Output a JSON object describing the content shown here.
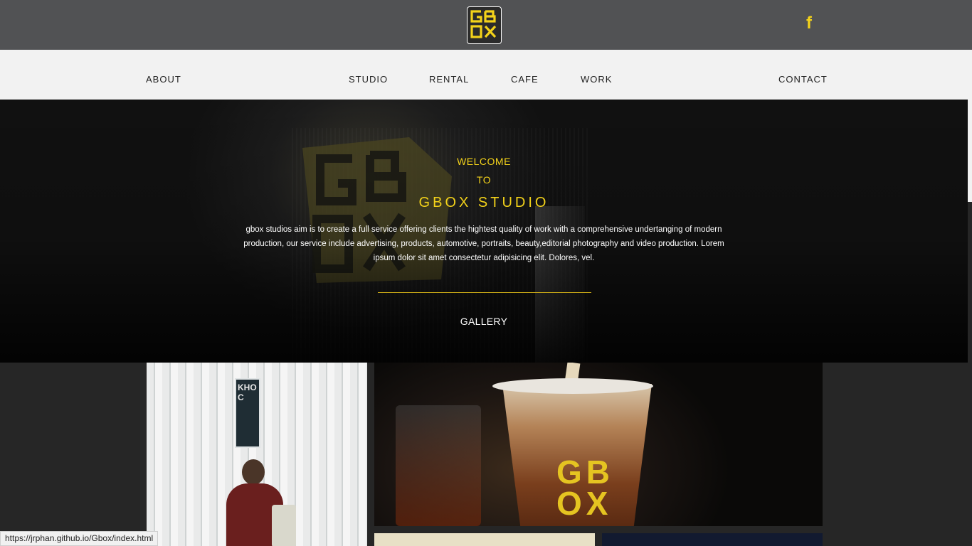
{
  "header": {
    "logo_text": "GBOX",
    "social_icon": "facebook-icon",
    "social_glyph": "f"
  },
  "nav": {
    "items": [
      {
        "label": "ABOUT"
      },
      {
        "label": "STUDIO"
      },
      {
        "label": "RENTAL"
      },
      {
        "label": "CAFE"
      },
      {
        "label": "WORK"
      },
      {
        "label": "CONTACT"
      }
    ]
  },
  "hero": {
    "welcome": "WELCOME",
    "to": "TO",
    "title": "GBOX STUDIO",
    "description": "gbox studios aim is to create a full service offering clients the hightest quality of work with a comprehensive undertanging of modern production, our service include advertising, products, automotive, portraits, beauty,editorial photography and video production. Lorem ipsum dolor sit amet consectetur adipisicing elit. Dolores, vel.",
    "gallery_title": "GALLERY"
  },
  "gallery": {
    "tile1_sign": "KHO C",
    "tile2_logo_line1": "GB",
    "tile2_logo_line2": "OX"
  },
  "statusbar": {
    "url": "https://jrphan.github.io/Gbox/index.html"
  },
  "colors": {
    "accent": "#f3d21a",
    "topbar": "#515254",
    "navbar": "#f2f2f2",
    "page_bg": "#262626"
  }
}
